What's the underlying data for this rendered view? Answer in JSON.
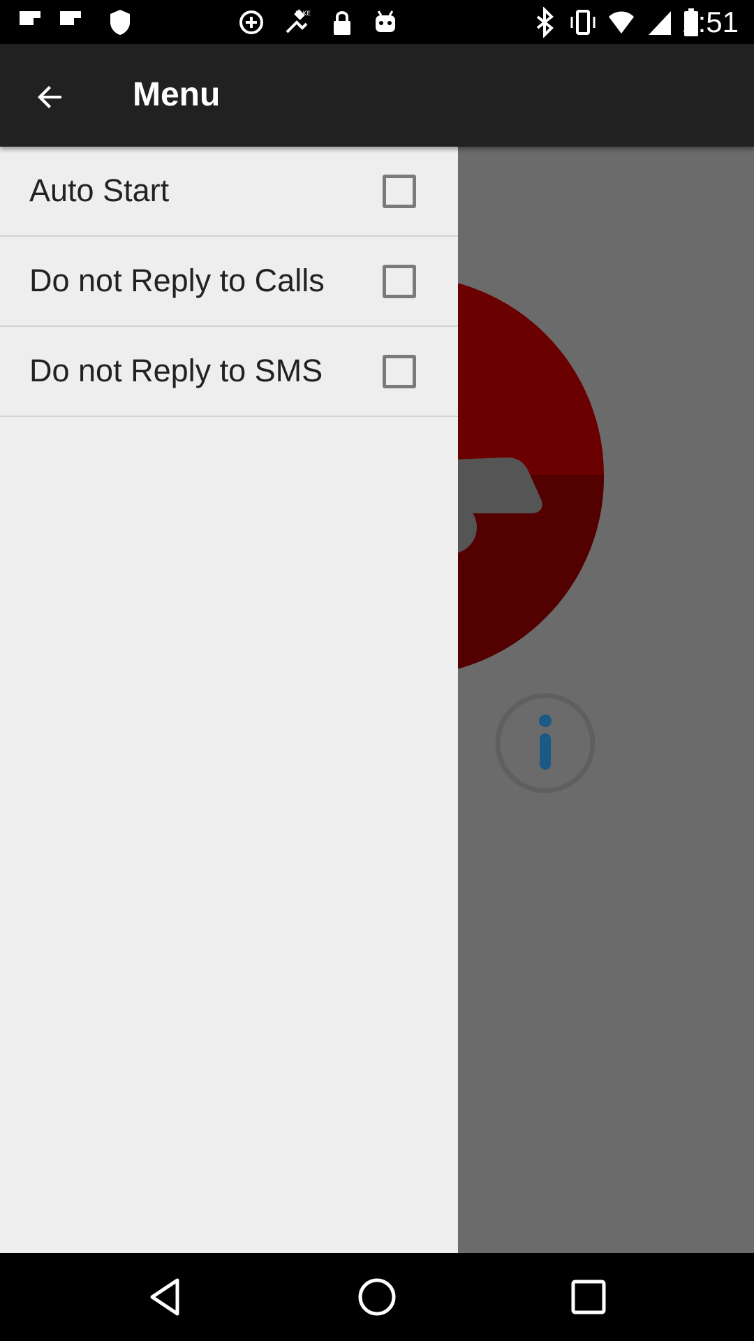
{
  "status_bar": {
    "time": "1:51",
    "left_icons": [
      "flipboard-icon",
      "flipboard-icon",
      "shield-icon",
      "data-saver-icon",
      "fake-gps-icon",
      "lock-icon",
      "android-icon"
    ],
    "right_icons": [
      "bluetooth-icon",
      "vibrate-icon",
      "wifi-icon",
      "signal-icon",
      "battery-icon"
    ]
  },
  "toolbar": {
    "title": "Menu",
    "back_icon": "arrow-back-icon"
  },
  "drawer": {
    "items": [
      {
        "label": "Auto Start",
        "checked": false
      },
      {
        "label": "Do not Reply to Calls",
        "checked": false
      },
      {
        "label": "Do not Reply to SMS",
        "checked": false
      }
    ]
  },
  "content": {
    "logo_icon": "car-logo-icon",
    "info_icon": "info-icon"
  },
  "nav_bar": {
    "back_icon": "nav-back-icon",
    "home_icon": "nav-home-icon",
    "recents_icon": "nav-recents-icon"
  },
  "colors": {
    "toolbar": "#212121",
    "drawer_bg": "#eeeeee",
    "scrim": "#6b6b6b",
    "logo_red": "#6b0000",
    "info_blue": "#1a5a85"
  }
}
